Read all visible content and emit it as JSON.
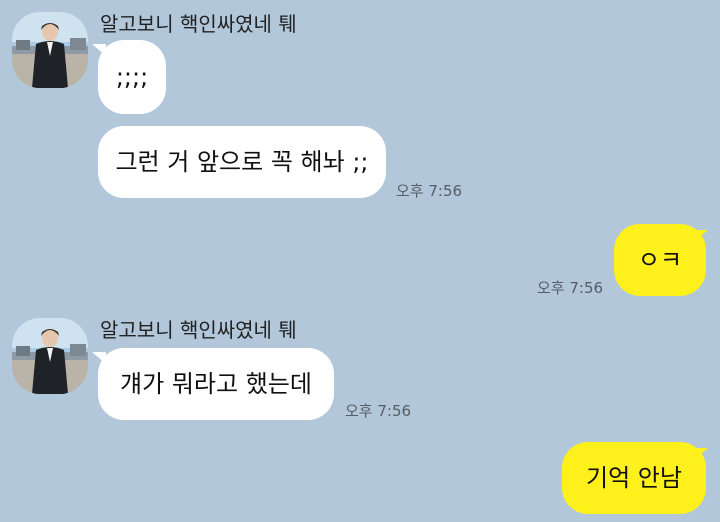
{
  "colors": {
    "background": "#b2c7d9",
    "incoming_bubble": "#ffffff",
    "outgoing_bubble": "#fef01b"
  },
  "messages": [
    {
      "sender": "알고보니 핵인싸였네 퉤",
      "direction": "in",
      "text": ";;;;",
      "time": ""
    },
    {
      "sender": "",
      "direction": "in",
      "text": "그런 거 앞으로 꼭 해놔 ;;",
      "time": "오후 7:56"
    },
    {
      "sender": "",
      "direction": "out",
      "text": "ㅇㅋ",
      "time": "오후 7:56"
    },
    {
      "sender": "알고보니 핵인싸였네 퉤",
      "direction": "in",
      "text": "걔가 뭐라고 했는데",
      "time": "오후 7:56"
    },
    {
      "sender": "",
      "direction": "out",
      "text": "기억 안남",
      "time": ""
    }
  ]
}
